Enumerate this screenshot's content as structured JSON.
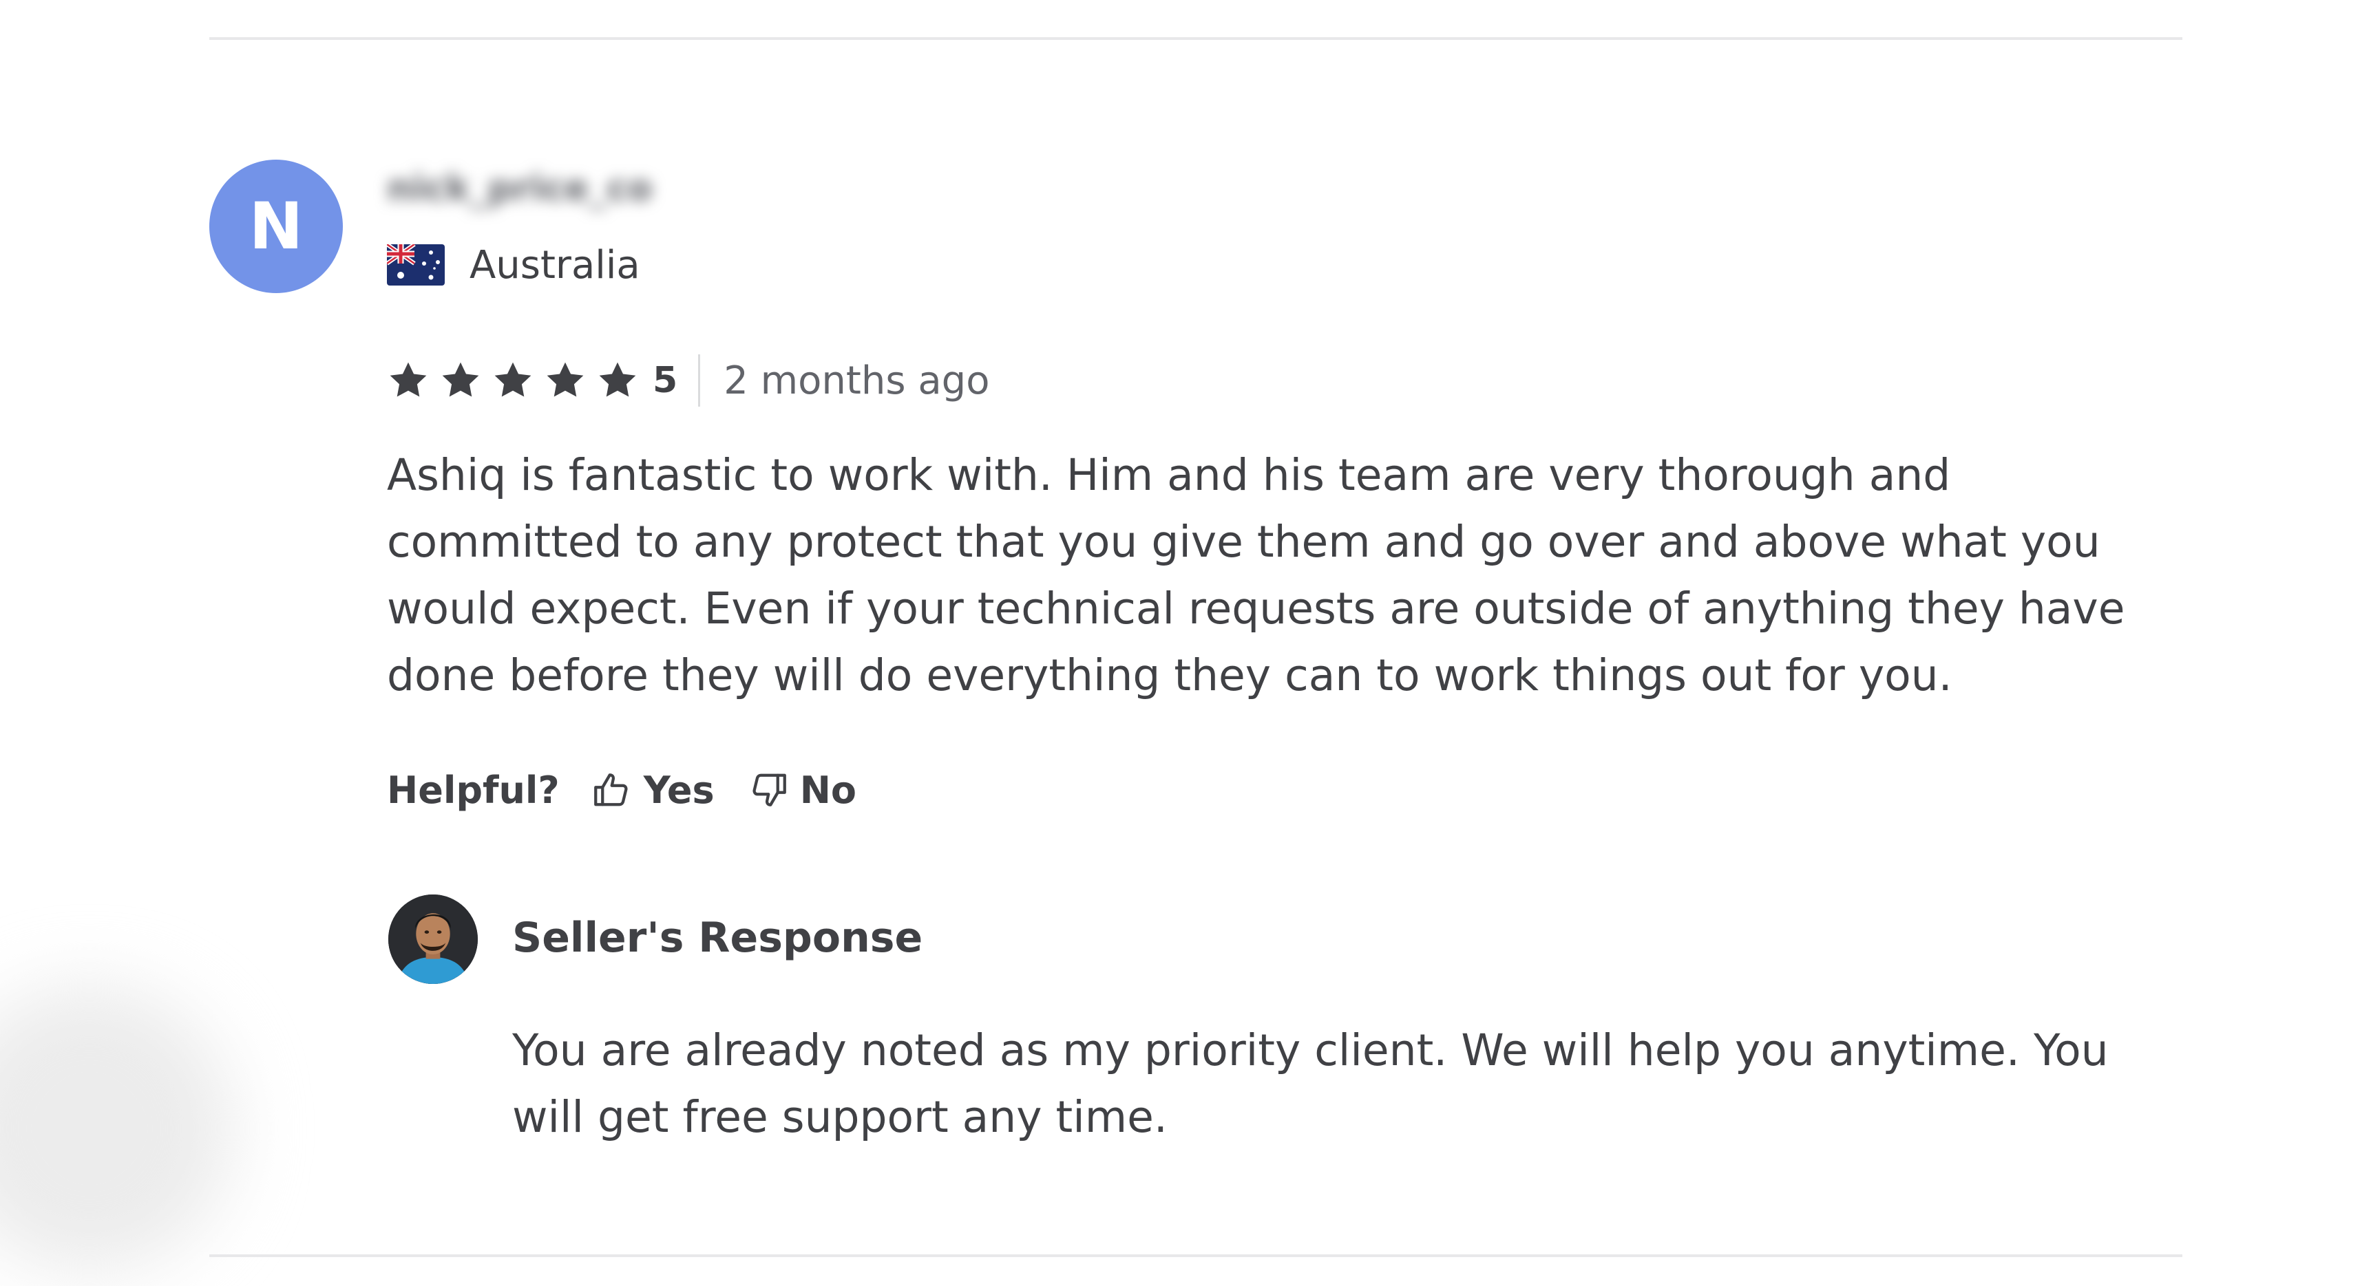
{
  "review": {
    "avatar_initial": "N",
    "username": "nick_price_co",
    "country": "Australia",
    "flag_icon": "australia-flag-icon",
    "rating": "5",
    "stars_filled": 5,
    "time_ago": "2 months ago",
    "text": "Ashiq is fantastic to work with. Him and his team are very thorough and committed to any protect that you give them and go over and above what you would expect. Even if your technical requests are outside of anything they have done before they will do everything they can to work things out for you."
  },
  "helpful": {
    "label": "Helpful?",
    "yes_label": "Yes",
    "no_label": "No"
  },
  "seller_response": {
    "title": "Seller's Response",
    "text": "You are already noted as my priority client. We will help you anytime. You will get free support any time."
  },
  "colors": {
    "avatar_bg": "#7393e8",
    "text_primary": "#404145",
    "text_secondary": "#62646a",
    "divider": "#e8e8ea"
  }
}
